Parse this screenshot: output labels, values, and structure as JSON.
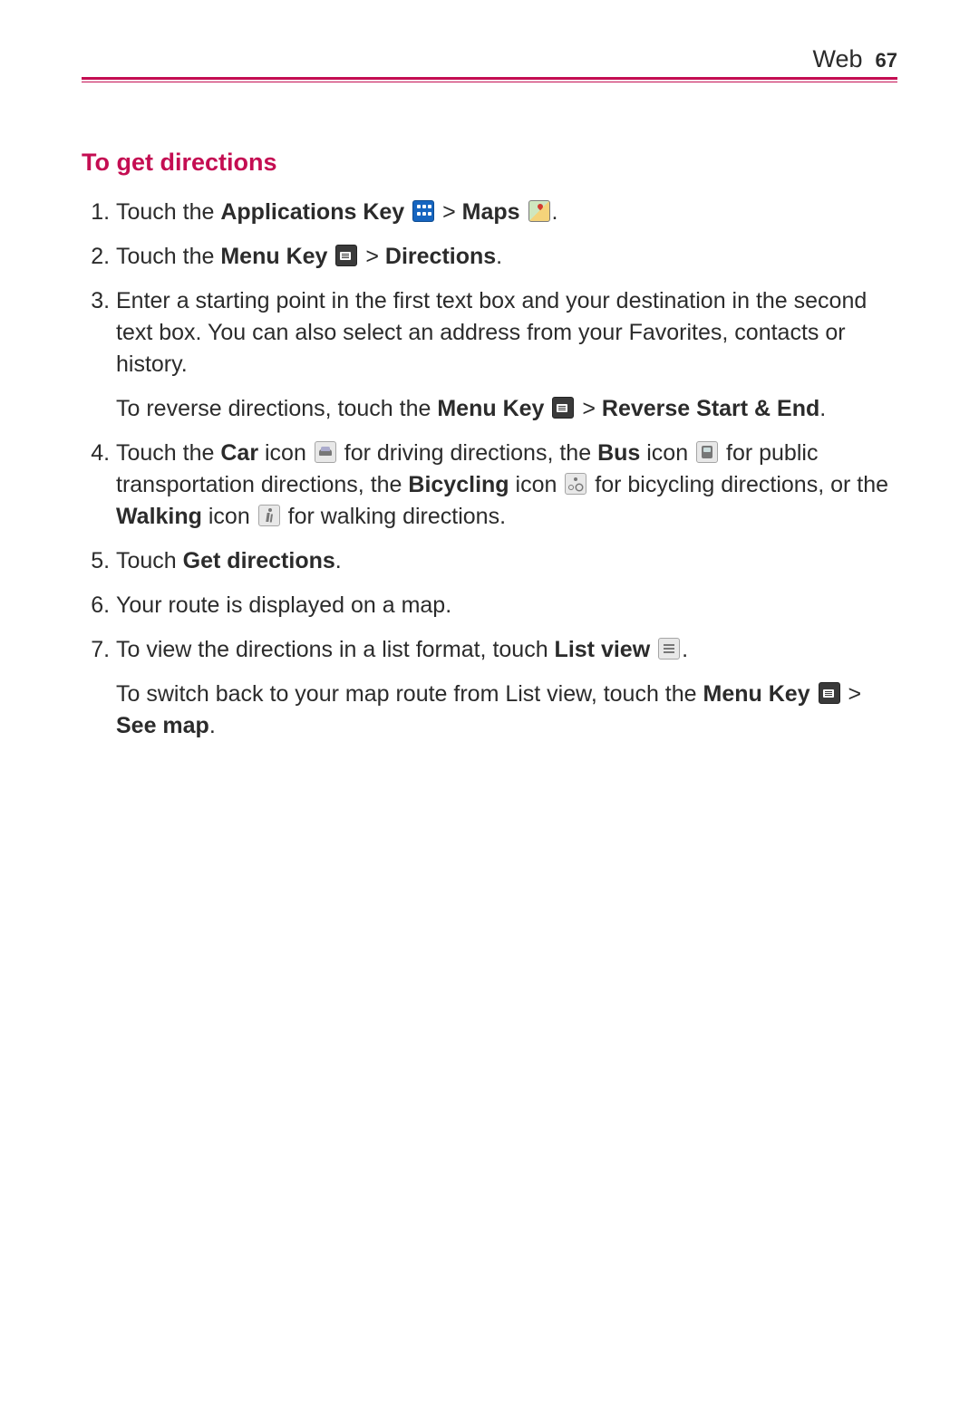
{
  "header": {
    "section": "Web",
    "page_number": "67"
  },
  "heading": "To get directions",
  "step1": {
    "t1": "Touch the ",
    "b1": "Applications Key",
    "t2": " > ",
    "b2": "Maps",
    "t3": "."
  },
  "step2": {
    "t1": "Touch the ",
    "b1": "Menu Key",
    "t2": " > ",
    "b2": "Directions",
    "t3": "."
  },
  "step3": {
    "main": "Enter a starting point in the first text box and your destination in the second text box. You can also select an address from your Favorites, contacts or history.",
    "sub_t1": "To reverse directions, touch the ",
    "sub_b1": "Menu Key",
    "sub_t2": " > ",
    "sub_b2": "Reverse Start & End",
    "sub_t3": "."
  },
  "step4": {
    "t1": "Touch the ",
    "b1": "Car",
    "t2": " icon ",
    "t3": " for driving directions, the ",
    "b2": "Bus",
    "t4": " icon ",
    "t5": " for public transportation directions, the ",
    "b3": "Bicycling",
    "t6": " icon ",
    "t7": " for bicycling directions, or the ",
    "b4": "Walking",
    "t8": " icon ",
    "t9": " for walking directions."
  },
  "step5": {
    "t1": "Touch ",
    "b1": "Get directions",
    "t2": "."
  },
  "step6": {
    "t1": "Your route is displayed on a map."
  },
  "step7": {
    "t1": "To view the directions in a list format, touch ",
    "b1": "List view",
    "t2": ".",
    "sub_t1": "To switch back to your map route from List view, touch the ",
    "sub_b1": "Menu Key",
    "sub_t2": " > ",
    "sub_b2": "See map",
    "sub_t3": "."
  }
}
